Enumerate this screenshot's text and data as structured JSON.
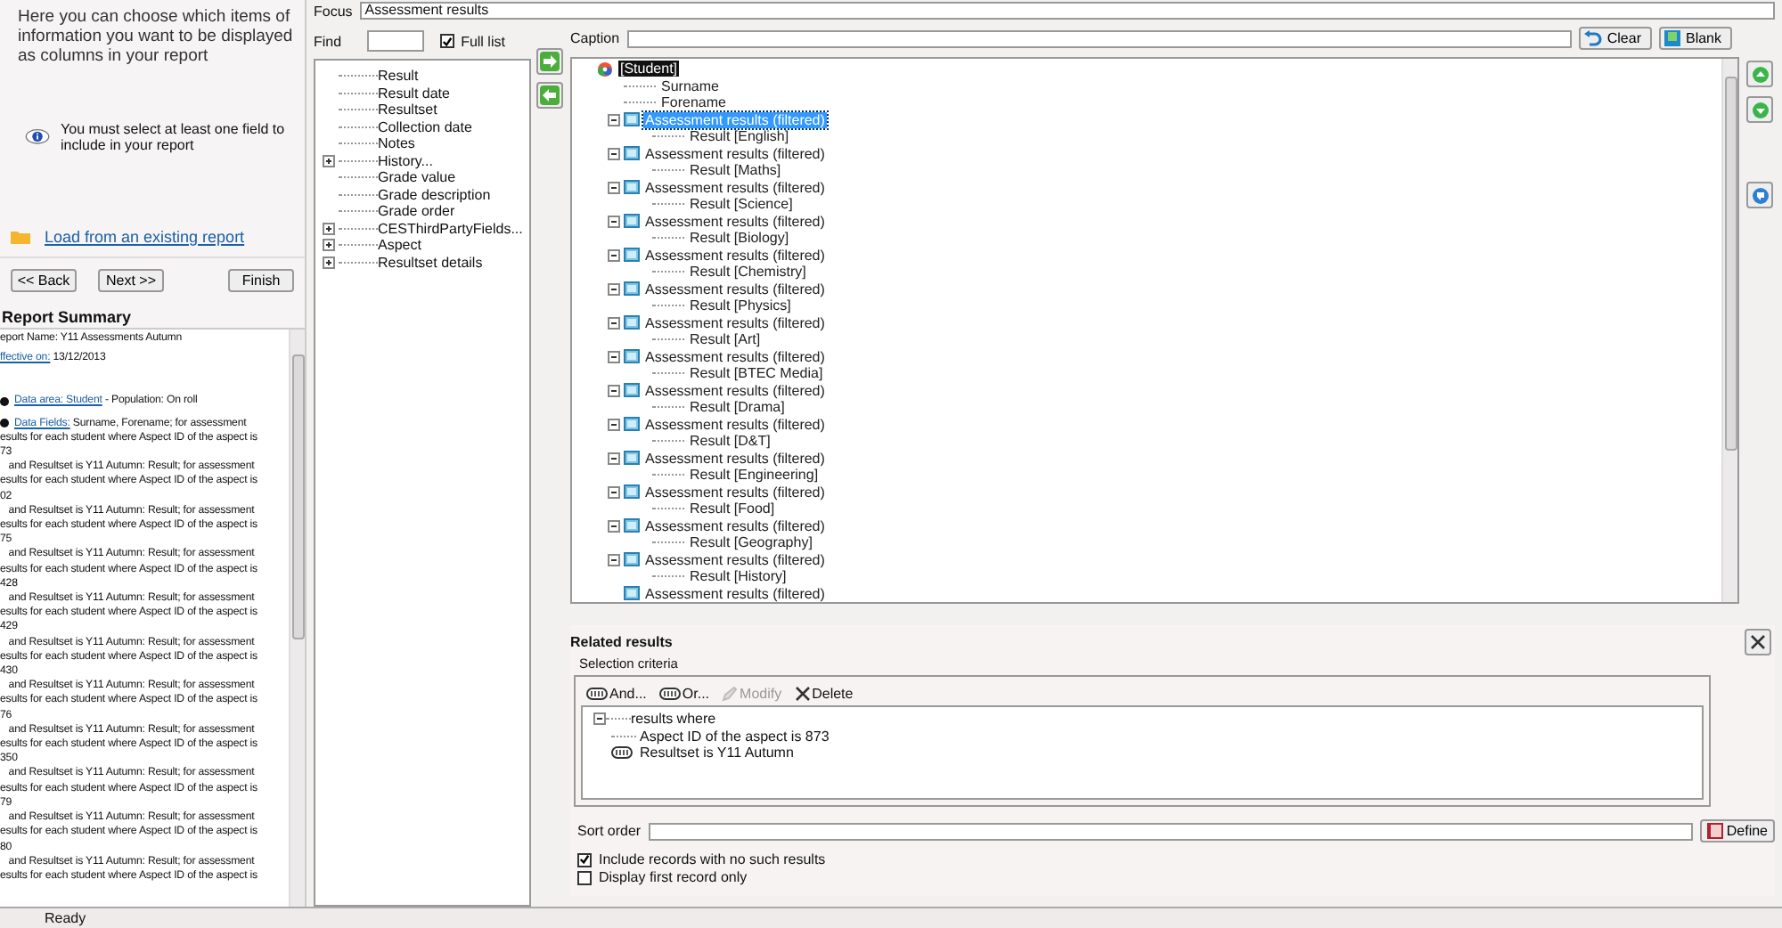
{
  "intro": "Here you can choose which items of information you want to be displayed as columns in your report",
  "notice": "You must select at least one field to include in your report",
  "load_link": "Load from an existing report",
  "nav_buttons": [
    {
      "label": "<< Back"
    },
    {
      "label": "Next >>"
    },
    {
      "label": "Finish"
    }
  ],
  "summary": {
    "title": "Report Summary",
    "name_line": "eport Name: Y11 Assessments Autumn",
    "effective": {
      "link": "ffective on:",
      "value": " 13/12/2013"
    },
    "data_area": {
      "link": "Data area: Student",
      "value": " - Population: On roll"
    },
    "data_fields": {
      "link": "Data Fields:",
      "first": " Surname, Forename; for assessment",
      "lines": [
        "esults for each student where Aspect ID of the aspect is",
        "73",
        "   and Resultset is Y11 Autumn: Result; for assessment",
        "esults for each student where Aspect ID of the aspect is",
        "02",
        "   and Resultset is Y11 Autumn: Result; for assessment",
        "esults for each student where Aspect ID of the aspect is",
        "75",
        "   and Resultset is Y11 Autumn: Result; for assessment",
        "esults for each student where Aspect ID of the aspect is",
        "428",
        "   and Resultset is Y11 Autumn: Result; for assessment",
        "esults for each student where Aspect ID of the aspect is",
        "429",
        "   and Resultset is Y11 Autumn: Result; for assessment",
        "esults for each student where Aspect ID of the aspect is",
        "430",
        "   and Resultset is Y11 Autumn: Result; for assessment",
        "esults for each student where Aspect ID of the aspect is",
        "76",
        "   and Resultset is Y11 Autumn: Result; for assessment",
        "esults for each student where Aspect ID of the aspect is",
        "350",
        "   and Resultset is Y11 Autumn: Result; for assessment",
        "esults for each student where Aspect ID of the aspect is",
        "79",
        "   and Resultset is Y11 Autumn: Result; for assessment",
        "esults for each student where Aspect ID of the aspect is",
        "80",
        "   and Resultset is Y11 Autumn: Result; for assessment",
        "esults for each student where Aspect ID of the aspect is"
      ]
    }
  },
  "focus": {
    "label": "Focus",
    "value": "Assessment results"
  },
  "find": {
    "label": "Find"
  },
  "full_list": {
    "label": "Full list",
    "checked": true
  },
  "field_tree": [
    {
      "label": "Result",
      "expandable": false
    },
    {
      "label": "Result date",
      "expandable": false
    },
    {
      "label": "Resultset",
      "expandable": false
    },
    {
      "label": "Collection date",
      "expandable": false
    },
    {
      "label": "Notes",
      "expandable": false
    },
    {
      "label": "History...",
      "expandable": true
    },
    {
      "label": "Grade value",
      "expandable": false
    },
    {
      "label": "Grade description",
      "expandable": false
    },
    {
      "label": "Grade order",
      "expandable": false
    },
    {
      "label": "CESThirdPartyFields...",
      "expandable": true
    },
    {
      "label": "Aspect",
      "expandable": true
    },
    {
      "label": "Resultset details",
      "expandable": true
    }
  ],
  "caption": {
    "label": "Caption"
  },
  "caption_buttons": [
    {
      "label": "Clear",
      "kind": "clear"
    },
    {
      "label": "Blank",
      "kind": "blank"
    }
  ],
  "selected_tree": {
    "label": "[Student]",
    "selected": true,
    "children": [
      {
        "label": "Surname",
        "kind": "field",
        "selected": false
      },
      {
        "label": "Forename",
        "kind": "field",
        "selected": false
      },
      {
        "label": "Assessment results (filtered)",
        "kind": "group",
        "selected": true,
        "children": [
          {
            "label": "Result [English]",
            "kind": "field",
            "selected": false
          }
        ]
      },
      {
        "label": "Assessment results (filtered)",
        "kind": "group",
        "selected": false,
        "children": [
          {
            "label": "Result [Maths]",
            "kind": "field",
            "selected": false
          }
        ]
      },
      {
        "label": "Assessment results (filtered)",
        "kind": "group",
        "selected": false,
        "children": [
          {
            "label": "Result [Science]",
            "kind": "field",
            "selected": false
          }
        ]
      },
      {
        "label": "Assessment results (filtered)",
        "kind": "group",
        "selected": false,
        "children": [
          {
            "label": "Result [Biology]",
            "kind": "field",
            "selected": false
          }
        ]
      },
      {
        "label": "Assessment results (filtered)",
        "kind": "group",
        "selected": false,
        "children": [
          {
            "label": "Result [Chemistry]",
            "kind": "field",
            "selected": false
          }
        ]
      },
      {
        "label": "Assessment results (filtered)",
        "kind": "group",
        "selected": false,
        "children": [
          {
            "label": "Result [Physics]",
            "kind": "field",
            "selected": false
          }
        ]
      },
      {
        "label": "Assessment results (filtered)",
        "kind": "group",
        "selected": false,
        "children": [
          {
            "label": "Result [Art]",
            "kind": "field",
            "selected": false
          }
        ]
      },
      {
        "label": "Assessment results (filtered)",
        "kind": "group",
        "selected": false,
        "children": [
          {
            "label": "Result [BTEC Media]",
            "kind": "field",
            "selected": false
          }
        ]
      },
      {
        "label": "Assessment results (filtered)",
        "kind": "group",
        "selected": false,
        "children": [
          {
            "label": "Result [Drama]",
            "kind": "field",
            "selected": false
          }
        ]
      },
      {
        "label": "Assessment results (filtered)",
        "kind": "group",
        "selected": false,
        "children": [
          {
            "label": "Result [D&T]",
            "kind": "field",
            "selected": false
          }
        ]
      },
      {
        "label": "Assessment results (filtered)",
        "kind": "group",
        "selected": false,
        "children": [
          {
            "label": "Result [Engineering]",
            "kind": "field",
            "selected": false
          }
        ]
      },
      {
        "label": "Assessment results (filtered)",
        "kind": "group",
        "selected": false,
        "children": [
          {
            "label": "Result [Food]",
            "kind": "field",
            "selected": false
          }
        ]
      },
      {
        "label": "Assessment results (filtered)",
        "kind": "group",
        "selected": false,
        "children": [
          {
            "label": "Result [Geography]",
            "kind": "field",
            "selected": false
          }
        ]
      },
      {
        "label": "Assessment results (filtered)",
        "kind": "group",
        "selected": false,
        "children": [
          {
            "label": "Result [History]",
            "kind": "field",
            "selected": false
          }
        ]
      },
      {
        "label": "Assessment results (filtered)",
        "kind": "group",
        "selected": false
      }
    ]
  },
  "related": {
    "title": "Related results",
    "criteria_label": "Selection criteria",
    "toolbar": [
      {
        "label": "And...",
        "kind": "and",
        "disabled": false
      },
      {
        "label": "Or...",
        "kind": "or",
        "disabled": false
      },
      {
        "label": "Modify",
        "kind": "modify",
        "disabled": true
      },
      {
        "label": "Delete",
        "kind": "delete",
        "disabled": false
      }
    ],
    "criteria": {
      "label": "results where",
      "expanded": true,
      "children": [
        {
          "label": "Aspect ID of the aspect is 873",
          "kind": "plain"
        },
        {
          "label": "Resultset is Y11 Autumn",
          "kind": "and"
        }
      ]
    },
    "sort_order": {
      "label": "Sort order"
    },
    "define_button": "Define",
    "options": [
      {
        "label": "Include records with no such results",
        "checked": true
      },
      {
        "label": "Display first record only",
        "checked": false
      }
    ]
  },
  "status_bar": "Ready"
}
